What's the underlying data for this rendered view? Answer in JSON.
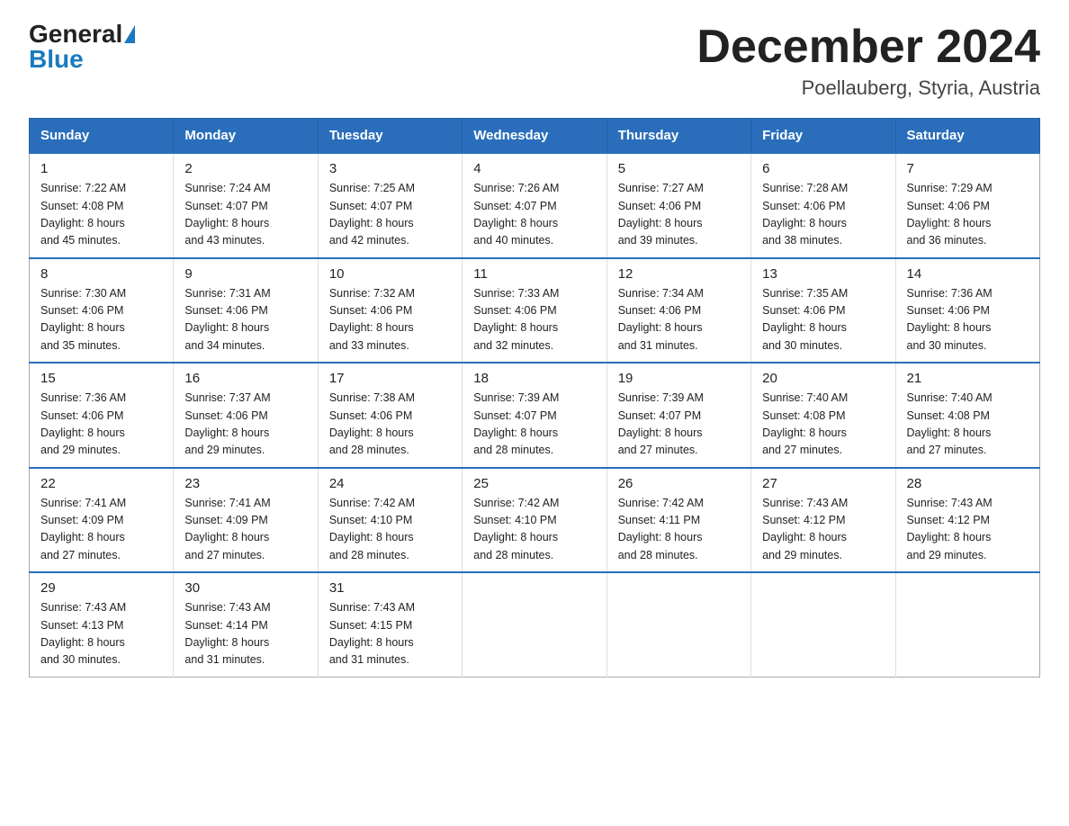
{
  "header": {
    "logo_general": "General",
    "logo_blue": "Blue",
    "title": "December 2024",
    "subtitle": "Poellauberg, Styria, Austria"
  },
  "days_of_week": [
    "Sunday",
    "Monday",
    "Tuesday",
    "Wednesday",
    "Thursday",
    "Friday",
    "Saturday"
  ],
  "weeks": [
    [
      {
        "day": "1",
        "sunrise": "7:22 AM",
        "sunset": "4:08 PM",
        "daylight": "8 hours and 45 minutes."
      },
      {
        "day": "2",
        "sunrise": "7:24 AM",
        "sunset": "4:07 PM",
        "daylight": "8 hours and 43 minutes."
      },
      {
        "day": "3",
        "sunrise": "7:25 AM",
        "sunset": "4:07 PM",
        "daylight": "8 hours and 42 minutes."
      },
      {
        "day": "4",
        "sunrise": "7:26 AM",
        "sunset": "4:07 PM",
        "daylight": "8 hours and 40 minutes."
      },
      {
        "day": "5",
        "sunrise": "7:27 AM",
        "sunset": "4:06 PM",
        "daylight": "8 hours and 39 minutes."
      },
      {
        "day": "6",
        "sunrise": "7:28 AM",
        "sunset": "4:06 PM",
        "daylight": "8 hours and 38 minutes."
      },
      {
        "day": "7",
        "sunrise": "7:29 AM",
        "sunset": "4:06 PM",
        "daylight": "8 hours and 36 minutes."
      }
    ],
    [
      {
        "day": "8",
        "sunrise": "7:30 AM",
        "sunset": "4:06 PM",
        "daylight": "8 hours and 35 minutes."
      },
      {
        "day": "9",
        "sunrise": "7:31 AM",
        "sunset": "4:06 PM",
        "daylight": "8 hours and 34 minutes."
      },
      {
        "day": "10",
        "sunrise": "7:32 AM",
        "sunset": "4:06 PM",
        "daylight": "8 hours and 33 minutes."
      },
      {
        "day": "11",
        "sunrise": "7:33 AM",
        "sunset": "4:06 PM",
        "daylight": "8 hours and 32 minutes."
      },
      {
        "day": "12",
        "sunrise": "7:34 AM",
        "sunset": "4:06 PM",
        "daylight": "8 hours and 31 minutes."
      },
      {
        "day": "13",
        "sunrise": "7:35 AM",
        "sunset": "4:06 PM",
        "daylight": "8 hours and 30 minutes."
      },
      {
        "day": "14",
        "sunrise": "7:36 AM",
        "sunset": "4:06 PM",
        "daylight": "8 hours and 30 minutes."
      }
    ],
    [
      {
        "day": "15",
        "sunrise": "7:36 AM",
        "sunset": "4:06 PM",
        "daylight": "8 hours and 29 minutes."
      },
      {
        "day": "16",
        "sunrise": "7:37 AM",
        "sunset": "4:06 PM",
        "daylight": "8 hours and 29 minutes."
      },
      {
        "day": "17",
        "sunrise": "7:38 AM",
        "sunset": "4:06 PM",
        "daylight": "8 hours and 28 minutes."
      },
      {
        "day": "18",
        "sunrise": "7:39 AM",
        "sunset": "4:07 PM",
        "daylight": "8 hours and 28 minutes."
      },
      {
        "day": "19",
        "sunrise": "7:39 AM",
        "sunset": "4:07 PM",
        "daylight": "8 hours and 27 minutes."
      },
      {
        "day": "20",
        "sunrise": "7:40 AM",
        "sunset": "4:08 PM",
        "daylight": "8 hours and 27 minutes."
      },
      {
        "day": "21",
        "sunrise": "7:40 AM",
        "sunset": "4:08 PM",
        "daylight": "8 hours and 27 minutes."
      }
    ],
    [
      {
        "day": "22",
        "sunrise": "7:41 AM",
        "sunset": "4:09 PM",
        "daylight": "8 hours and 27 minutes."
      },
      {
        "day": "23",
        "sunrise": "7:41 AM",
        "sunset": "4:09 PM",
        "daylight": "8 hours and 27 minutes."
      },
      {
        "day": "24",
        "sunrise": "7:42 AM",
        "sunset": "4:10 PM",
        "daylight": "8 hours and 28 minutes."
      },
      {
        "day": "25",
        "sunrise": "7:42 AM",
        "sunset": "4:10 PM",
        "daylight": "8 hours and 28 minutes."
      },
      {
        "day": "26",
        "sunrise": "7:42 AM",
        "sunset": "4:11 PM",
        "daylight": "8 hours and 28 minutes."
      },
      {
        "day": "27",
        "sunrise": "7:43 AM",
        "sunset": "4:12 PM",
        "daylight": "8 hours and 29 minutes."
      },
      {
        "day": "28",
        "sunrise": "7:43 AM",
        "sunset": "4:12 PM",
        "daylight": "8 hours and 29 minutes."
      }
    ],
    [
      {
        "day": "29",
        "sunrise": "7:43 AM",
        "sunset": "4:13 PM",
        "daylight": "8 hours and 30 minutes."
      },
      {
        "day": "30",
        "sunrise": "7:43 AM",
        "sunset": "4:14 PM",
        "daylight": "8 hours and 31 minutes."
      },
      {
        "day": "31",
        "sunrise": "7:43 AM",
        "sunset": "4:15 PM",
        "daylight": "8 hours and 31 minutes."
      },
      null,
      null,
      null,
      null
    ]
  ],
  "labels": {
    "sunrise": "Sunrise:",
    "sunset": "Sunset:",
    "daylight": "Daylight:"
  }
}
